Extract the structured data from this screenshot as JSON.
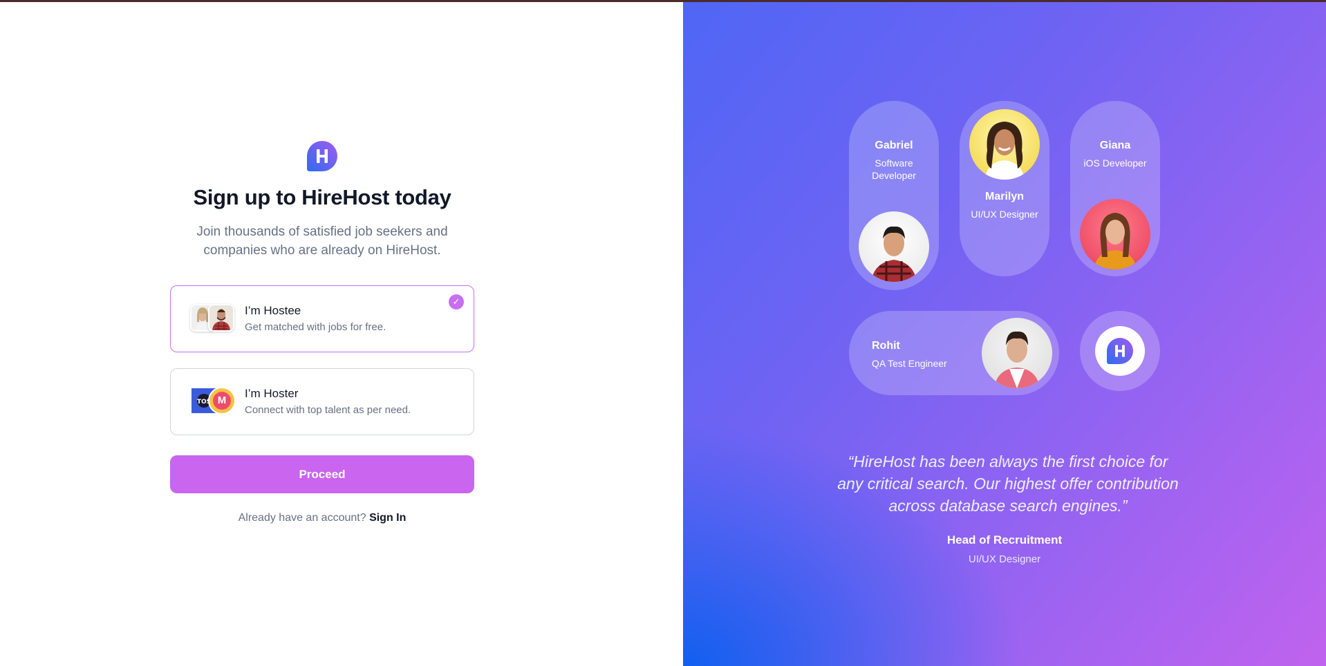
{
  "signup": {
    "title": "Sign up to HireHost today",
    "subtitle": "Join thousands of satisfied job seekers and companies who are already on HireHost.",
    "options": [
      {
        "title": "I’m Hostee",
        "description": "Get matched with jobs for free.",
        "selected": true
      },
      {
        "title": "I’m Hoster",
        "description": "Connect with top talent as per need.",
        "selected": false
      }
    ],
    "proceed_label": "Proceed",
    "account_prompt": "Already have an account?",
    "signin_label": "Sign In"
  },
  "showcase": {
    "people": [
      {
        "name": "Gabriel",
        "role": "Software Developer"
      },
      {
        "name": "Marilyn",
        "role": "UI/UX Designer"
      },
      {
        "name": "Giana",
        "role": "iOS Developer"
      },
      {
        "name": "Rohit",
        "role": "QA Test Engineer"
      }
    ],
    "quote": "“HireHost has been always the first choice for any critical search. Our highest offer contribution across database search engines.”",
    "quote_author": "Head of Recruitment",
    "quote_role": "UI/UX Designer"
  },
  "colors": {
    "accent": "#c965ee",
    "brand_blue": "#3b5bdb",
    "gradient_start": "#0b5fef",
    "gradient_end": "#c063ee"
  },
  "icons": [
    "hirehost-logo-icon",
    "check-icon",
    "avatar-photo"
  ]
}
